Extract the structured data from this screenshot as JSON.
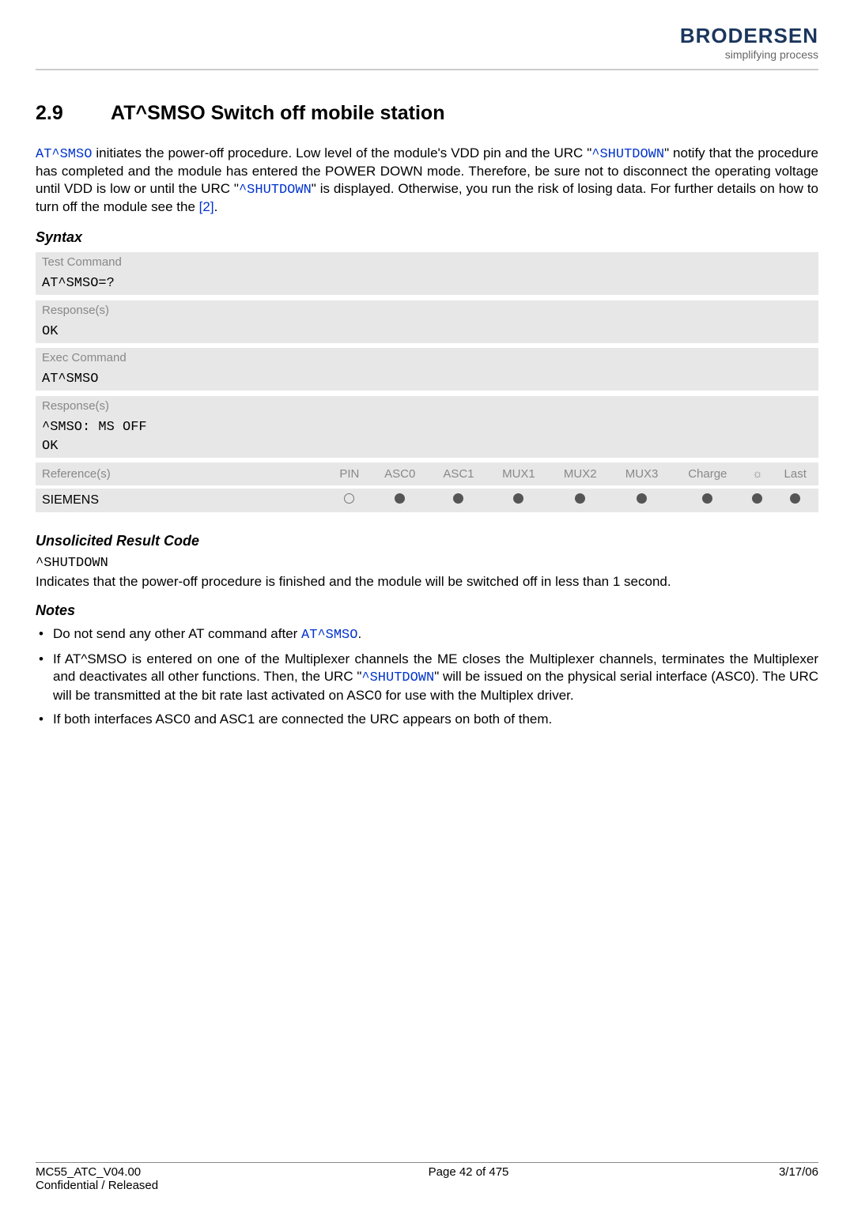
{
  "header": {
    "brand": "BRODERSEN",
    "tagline": "simplifying process"
  },
  "section": {
    "number": "2.9",
    "title": "AT^SMSO   Switch off mobile station"
  },
  "intro": {
    "cmd1": "AT^SMSO",
    "p1a": " initiates the power-off procedure. Low level of the module's VDD pin and the URC \"",
    "urc1": "^SHUTDOWN",
    "p1b": "\" notify that the procedure has completed and the module has entered the POWER DOWN mode. Therefore, be sure not to disconnect the operating voltage until VDD is low or until the URC \"",
    "urc2": "^SHUTDOWN",
    "p1c": "\" is displayed. Otherwise, you run the risk of losing data. For further details on how to turn off the module see the ",
    "ref": "[2]",
    "p1d": "."
  },
  "syntax": {
    "heading": "Syntax",
    "test_label": "Test Command",
    "test_cmd": "AT^SMSO=?",
    "resp_label": "Response(s)",
    "ok": "OK",
    "exec_label": "Exec Command",
    "exec_cmd": "AT^SMSO",
    "exec_resp": "^SMSO: MS OFF",
    "ref_label": "Reference(s)",
    "cols": {
      "pin": "PIN",
      "asc0": "ASC0",
      "asc1": "ASC1",
      "mux1": "MUX1",
      "mux2": "MUX2",
      "mux3": "MUX3",
      "charge": "Charge",
      "last": "Last"
    },
    "vendor": "SIEMENS"
  },
  "urc": {
    "heading": "Unsolicited Result Code",
    "code": "^SHUTDOWN",
    "text": "Indicates that the power-off procedure is finished and the module will be switched off in less than 1 second."
  },
  "notes": {
    "heading": "Notes",
    "n1a": "Do not send any other AT command after ",
    "n1cmd": "AT^SMSO",
    "n1b": ".",
    "n2a": "If AT^SMSO is entered on one of the Multiplexer channels the ME closes the Multiplexer channels, terminates the Multiplexer and deactivates all other functions. Then, the URC \"",
    "n2urc": "^SHUTDOWN",
    "n2b": "\" will be issued on the physical serial interface (ASC0). The URC will be transmitted at the bit rate last activated on ASC0 for use with the Multiplex driver.",
    "n3": "If both interfaces ASC0 and ASC1 are connected the URC appears on both of them."
  },
  "footer": {
    "left1": "MC55_ATC_V04.00",
    "left2": "Confidential / Released",
    "center": "Page 42 of 475",
    "right": "3/17/06"
  }
}
